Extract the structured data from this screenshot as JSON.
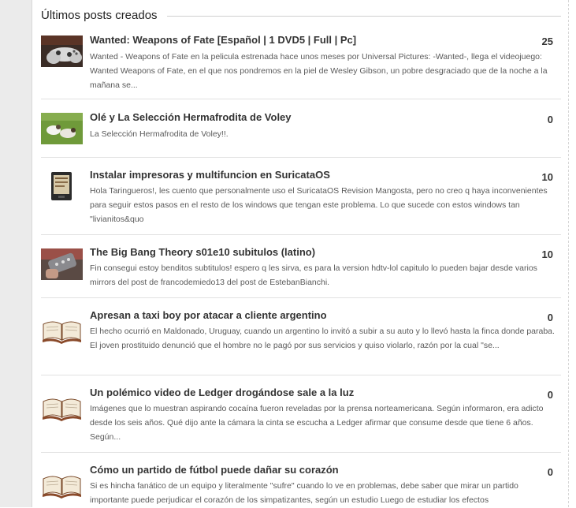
{
  "section": {
    "title": "Últimos posts creados"
  },
  "posts": [
    {
      "title": "Wanted: Weapons of Fate [Español | 1 DVD5 | Full | Pc]",
      "excerpt": "Wanted - Weapons of Fate en la pelicula estrenada hace unos meses por Universal Pictures: -Wanted-, llega el videojuego: Wanted Weapons of Fate, en el que nos pondremos en la piel de Wesley Gibson, un pobre desgraciado que de la noche a la mañana se...",
      "count": "25",
      "thumb": "gamepad-thumbnail"
    },
    {
      "title": "Olé y La Selección Hermafrodita de Voley",
      "excerpt": "La Selección Hermafrodita de Voley!!.",
      "count": "0",
      "thumb": "animals-on-grass-thumbnail"
    },
    {
      "title": "Instalar impresoras y multifuncion en SuricataOS",
      "excerpt": "Hola Taringueros!, les cuento que personalmente uso el SuricataOS Revision Mangosta, pero no creo q haya inconvenientes para seguir estos pasos en el resto de los windows que tengan este problema. Lo que sucede con estos windows tan \"livianitos&quo",
      "count": "10",
      "thumb": "ebook-reader-thumbnail"
    },
    {
      "title": "The Big Bang Theory s01e10 subitulos (latino)",
      "excerpt": "Fin consegui estoy benditos subtitulos! espero q les sirva, es para la version hdtv-lol capitulo lo pueden bajar desde varios mirrors del post de francodemiedo13 del post de EstebanBianchi.",
      "count": "10",
      "thumb": "remote-control-thumbnail"
    },
    {
      "title": "Apresan a taxi boy por atacar a cliente argentino",
      "excerpt": "El hecho ocurrió en Maldonado, Uruguay, cuando un argentino lo invitó a subir a su auto y lo llevó hasta la finca donde paraba. El joven prostituido denunció que el hombre no le pagó por sus servicios y quiso violarlo, razón por la cual \"se...",
      "count": "0",
      "thumb": "open-book-thumbnail"
    },
    {
      "title": "Un polémico video de Ledger drogándose sale a la luz",
      "excerpt": "Imágenes que lo muestran aspirando cocaína fueron reveladas por la prensa norteamericana. Según informaron, era adicto desde los seis años. Qué dijo ante la cámara la cinta se escucha a Ledger afirmar que consume desde que tiene 6 años. Según...",
      "count": "0",
      "thumb": "open-book-thumbnail"
    },
    {
      "title": "Cómo un partido de fútbol puede dañar su corazón",
      "excerpt": "Si es hincha fanático de un equipo y literalmente \"sufre\" cuando lo ve en problemas, debe saber que mirar un partido importante puede perjudicar el corazón de los simpatizantes, según un estudio Luego de estudiar los efectos",
      "count": "0",
      "thumb": "open-book-thumbnail"
    }
  ]
}
